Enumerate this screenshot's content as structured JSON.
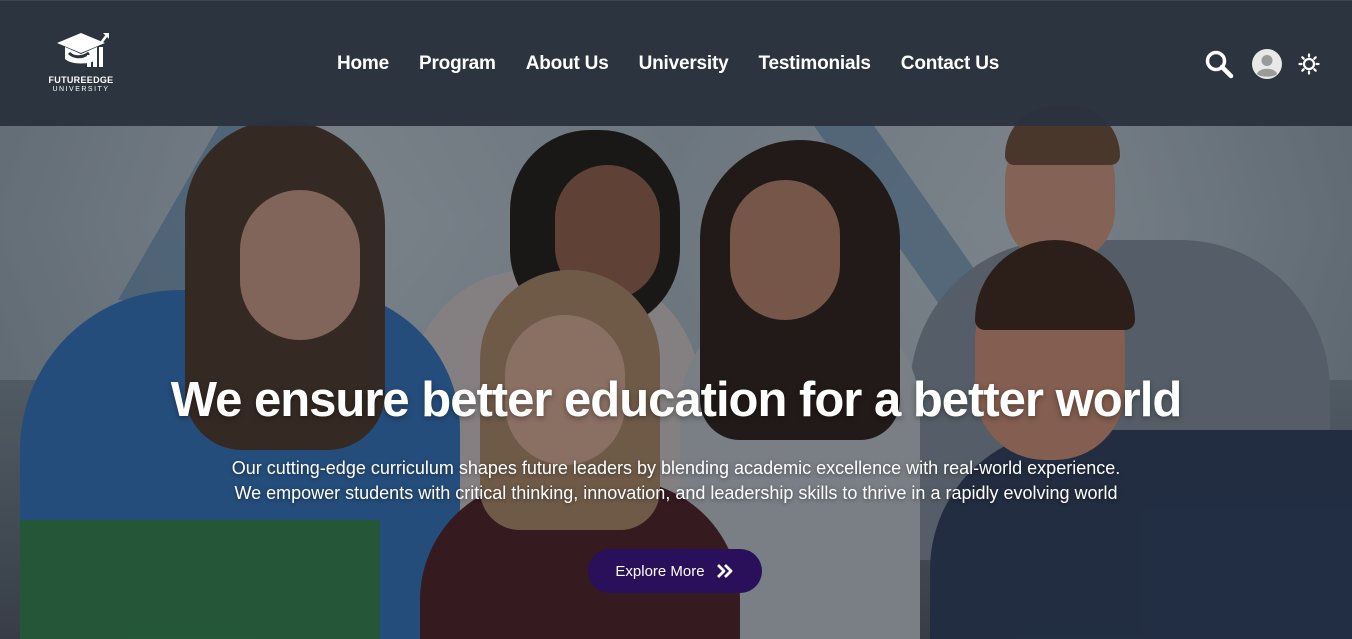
{
  "brand": {
    "name_top": "FUTUREEDGE",
    "name_bottom": "UNIVERSITY",
    "logo_icon": "graduation-cap-icon"
  },
  "nav": {
    "items": [
      {
        "label": "Home"
      },
      {
        "label": "Program"
      },
      {
        "label": "About Us"
      },
      {
        "label": "University"
      },
      {
        "label": "Testimonials"
      },
      {
        "label": "Contact Us"
      }
    ]
  },
  "toolbar": {
    "search_icon": "search-icon",
    "profile_icon": "avatar-icon",
    "theme_icon": "sun-icon"
  },
  "hero": {
    "headline": "We ensure better education for a better world",
    "subtext": "Our cutting-edge curriculum shapes future leaders by blending academic excellence with real-world experience. We empower students with critical thinking, innovation, and leadership skills to thrive in a rapidly evolving world",
    "cta_label": "Explore More",
    "cta_icon": "double-chevron-right-icon"
  },
  "colors": {
    "navbar_bg": "#2b333e",
    "cta_bg": "#2a0f5a",
    "text": "#ffffff"
  }
}
